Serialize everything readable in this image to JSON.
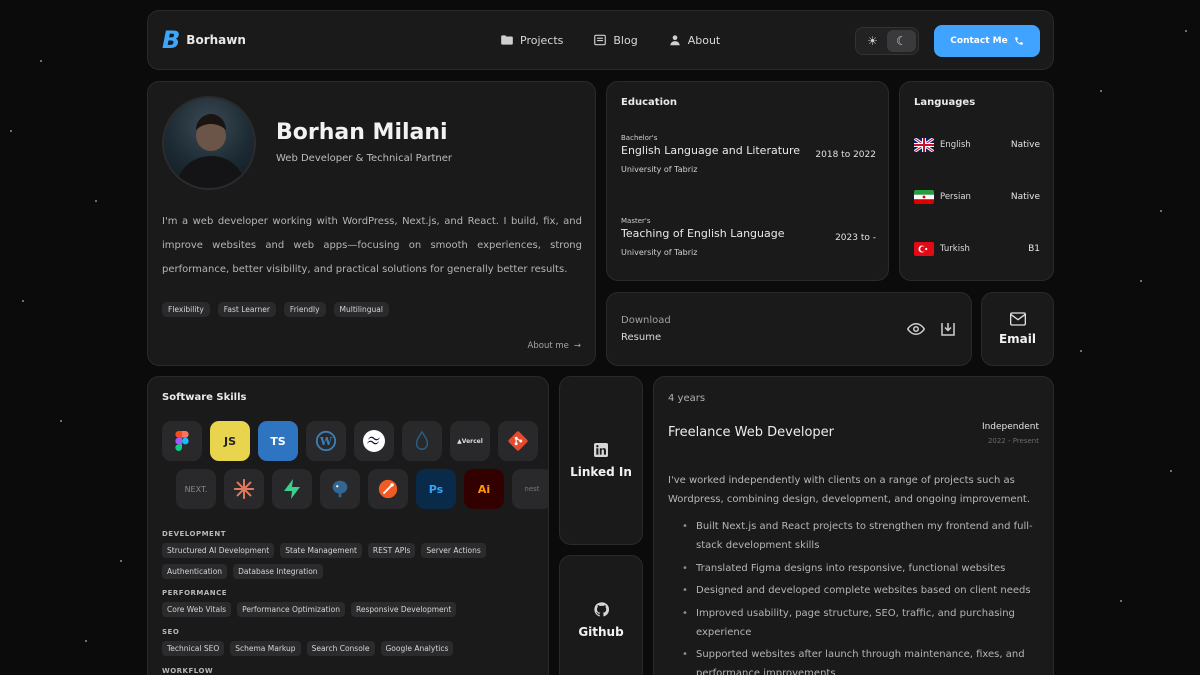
{
  "nav": {
    "brand": "Borhawn",
    "logo_letter": "B",
    "links": [
      {
        "label": "Projects",
        "icon": "folder-icon"
      },
      {
        "label": "Blog",
        "icon": "newspaper-icon"
      },
      {
        "label": "About",
        "icon": "user-icon"
      }
    ],
    "theme": {
      "light_icon": "☀",
      "dark_icon": "☾",
      "active": "dark"
    },
    "contact_label": "Contact Me"
  },
  "profile": {
    "name": "Borhan Milani",
    "role": "Web Developer & Technical Partner",
    "bio": "I'm a web developer working with WordPress, Next.js, and React. I build, fix, and improve websites and web apps—focusing on smooth experiences, strong performance, better visibility, and practical solutions for generally better results.",
    "tags": [
      "Flexibility",
      "Fast Learner",
      "Friendly",
      "Multilingual"
    ],
    "about_link": "About me"
  },
  "education": {
    "title": "Education",
    "items": [
      {
        "degree": "Bachelor's",
        "field": "English Language and Literature",
        "university": "University of Tabriz",
        "years": "2018 to 2022"
      },
      {
        "degree": "Master's",
        "field": "Teaching of English Language",
        "university": "University of Tabriz",
        "years": "2023 to -"
      }
    ]
  },
  "languages": {
    "title": "Languages",
    "items": [
      {
        "name": "English",
        "level": "Native",
        "flag": "uk-flag-icon"
      },
      {
        "name": "Persian",
        "level": "Native",
        "flag": "iran-flag-icon"
      },
      {
        "name": "Turkish",
        "level": "B1",
        "flag": "turkey-flag-icon"
      }
    ]
  },
  "resume": {
    "line1": "Download",
    "line2": "Resume"
  },
  "email": {
    "label": "Email"
  },
  "linkedin": {
    "label": "Linked In"
  },
  "github": {
    "label": "Github"
  },
  "skills": {
    "title": "Software Skills",
    "row1": [
      {
        "icon": "figma-icon",
        "text": ""
      },
      {
        "icon": "javascript-icon",
        "text": "JS"
      },
      {
        "icon": "typescript-icon",
        "text": "TS"
      },
      {
        "icon": "wordpress-icon",
        "text": ""
      },
      {
        "icon": "tailwind-icon",
        "text": ""
      },
      {
        "icon": "mysql-icon",
        "text": ""
      },
      {
        "icon": "vercel-icon",
        "text": "▲Vercel"
      },
      {
        "icon": "git-icon",
        "text": ""
      }
    ],
    "row2": [
      {
        "icon": "nextjs-icon",
        "text": "NEXT."
      },
      {
        "icon": "claude-icon",
        "text": ""
      },
      {
        "icon": "supabase-icon",
        "text": ""
      },
      {
        "icon": "postgresql-icon",
        "text": ""
      },
      {
        "icon": "postman-icon",
        "text": ""
      },
      {
        "icon": "photoshop-icon",
        "text": "Ps"
      },
      {
        "icon": "illustrator-icon",
        "text": "Ai"
      },
      {
        "icon": "nest-icon",
        "text": "nest"
      }
    ],
    "sections": [
      {
        "name": "DEVELOPMENT",
        "chips": [
          "Structured AI Development",
          "State Management",
          "REST APIs",
          "Server Actions",
          "Authentication",
          "Database Integration"
        ]
      },
      {
        "name": "PERFORMANCE",
        "chips": [
          "Core Web Vitals",
          "Performance Optimization",
          "Responsive Development"
        ]
      },
      {
        "name": "SEO",
        "chips": [
          "Technical SEO",
          "Schema Markup",
          "Search Console",
          "Google Analytics"
        ]
      },
      {
        "name": "WORKFLOW",
        "chips": []
      }
    ]
  },
  "experience": {
    "duration": "4 years",
    "title": "Freelance Web Developer",
    "company": "Independent",
    "period": "2022 - Present",
    "description": "I've worked independently with clients on a range of projects such as Wordpress, combining design, development, and ongoing improvement.",
    "bullets": [
      "Built Next.js and React projects to strengthen my frontend and full-stack development skills",
      "Translated Figma designs into responsive, functional websites",
      "Designed and developed complete websites based on client needs",
      "Improved usability, page structure, SEO, traffic, and purchasing experience",
      "Supported websites after launch through maintenance, fixes, and performance improvements"
    ]
  },
  "colors": {
    "accent": "#3fa3ff",
    "background": "#0b0b0c",
    "card": "#1a1a1b"
  }
}
